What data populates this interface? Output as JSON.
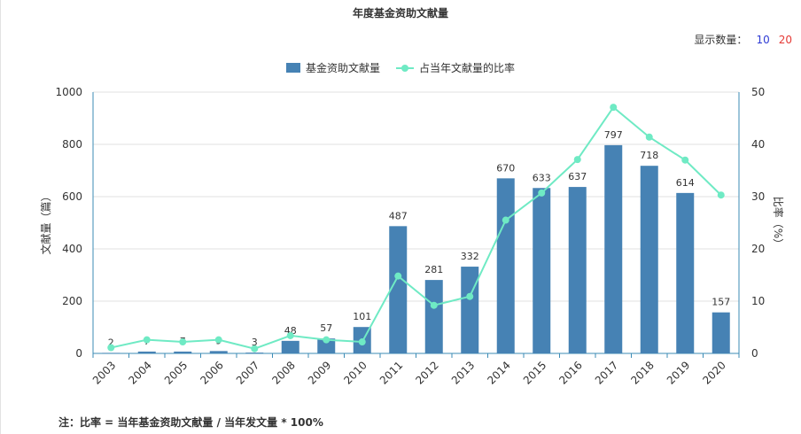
{
  "title": "年度基金资助文献量",
  "display_control": {
    "label": "显示数量：",
    "options": [
      {
        "label": "10",
        "color": "#2e3bd4"
      },
      {
        "label": "20",
        "color": "#e53935"
      }
    ]
  },
  "legend": {
    "bar_label": "基金资助文献量",
    "line_label": "占当年文献量的比率"
  },
  "note": "注：比率 = 当年基金资助文献量 / 当年发文量 * 100%",
  "colors": {
    "bar": "#4682b4",
    "line": "#6feac4",
    "axis": "#3b8bb5",
    "grid": "#e2e2e2",
    "text": "#333333"
  },
  "chart_data": {
    "type": "bar+line",
    "categories": [
      "2003",
      "2004",
      "2005",
      "2006",
      "2007",
      "2008",
      "2009",
      "2010",
      "2011",
      "2012",
      "2013",
      "2014",
      "2015",
      "2016",
      "2017",
      "2018",
      "2019",
      "2020"
    ],
    "series": [
      {
        "name": "基金资助文献量",
        "type": "bar",
        "axis": "left",
        "values": [
          2,
          7,
          7,
          9,
          3,
          48,
          57,
          101,
          487,
          281,
          332,
          670,
          633,
          637,
          797,
          718,
          614,
          157
        ]
      },
      {
        "name": "占当年文献量的比率",
        "type": "line",
        "axis": "right",
        "values": [
          1.1,
          2.6,
          2.2,
          2.6,
          0.9,
          3.4,
          2.6,
          2.2,
          14.8,
          9.2,
          10.9,
          25.5,
          30.7,
          37.1,
          47.1,
          41.4,
          37.0,
          30.3
        ]
      }
    ],
    "ylabel_left": "文献量（篇）",
    "ylabel_right": "比率（%）",
    "ylim_left": [
      0,
      1000
    ],
    "yticks_left": [
      0,
      200,
      400,
      600,
      800,
      1000
    ],
    "ylim_right": [
      0,
      50
    ],
    "yticks_right": [
      0,
      10,
      20,
      30,
      40,
      50
    ],
    "grid": true,
    "legend_position": "top-center"
  }
}
